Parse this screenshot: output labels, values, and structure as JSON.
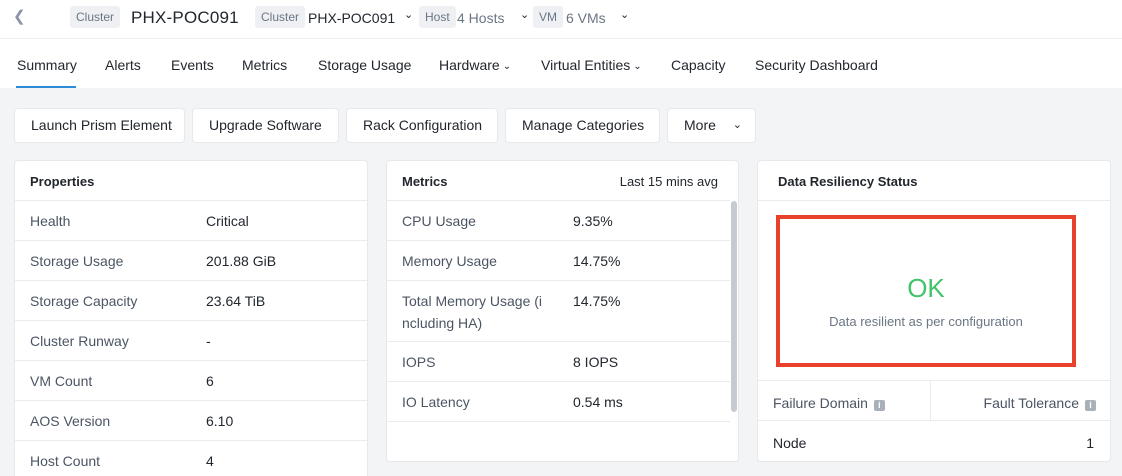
{
  "breadcrumb": {
    "cluster_chip": "Cluster",
    "cluster_name": "PHX-POC091",
    "cluster_chip2": "Cluster",
    "cluster_select": "PHX-POC091",
    "host_chip": "Host",
    "host_value": "4 Hosts",
    "vm_chip": "VM",
    "vm_value": "6 VMs"
  },
  "tabs": [
    {
      "label": "Summary",
      "active": true
    },
    {
      "label": "Alerts"
    },
    {
      "label": "Events"
    },
    {
      "label": "Metrics"
    },
    {
      "label": "Storage Usage"
    },
    {
      "label": "Hardware"
    },
    {
      "label": "Virtual Entities"
    },
    {
      "label": "Capacity"
    },
    {
      "label": "Security Dashboard"
    }
  ],
  "actions": {
    "launch": "Launch Prism Element",
    "upgrade": "Upgrade Software",
    "rack": "Rack Configuration",
    "categories": "Manage Categories",
    "more": "More"
  },
  "properties": {
    "title": "Properties",
    "rows": [
      {
        "label": "Health",
        "value": "Critical"
      },
      {
        "label": "Storage Usage",
        "value": "201.88 GiB"
      },
      {
        "label": "Storage Capacity",
        "value": "23.64 TiB"
      },
      {
        "label": "Cluster Runway",
        "value": "-"
      },
      {
        "label": "VM Count",
        "value": "6"
      },
      {
        "label": "AOS Version",
        "value": "6.10"
      },
      {
        "label": "Host Count",
        "value": "4"
      }
    ]
  },
  "metrics": {
    "title": "Metrics",
    "period": "Last 15 mins avg",
    "rows": [
      {
        "label": "CPU Usage",
        "value": "9.35%"
      },
      {
        "label": "Memory Usage",
        "value": "14.75%"
      },
      {
        "label": "Total Memory Usage (i",
        "label2": "ncluding HA)",
        "value": "14.75%"
      },
      {
        "label": "IOPS",
        "value": "8 IOPS"
      },
      {
        "label": "IO Latency",
        "value": "0.54 ms"
      }
    ]
  },
  "resiliency": {
    "title": "Data Resiliency Status",
    "status": "OK",
    "status_color": "#3fc46a",
    "message": "Data resilient as per configuration",
    "col_failure": "Failure Domain",
    "col_tolerance": "Fault Tolerance",
    "row_domain": "Node",
    "row_tolerance": "1"
  },
  "colors": {
    "accent": "#2d8cd7",
    "highlight_box": "#e8412c"
  }
}
